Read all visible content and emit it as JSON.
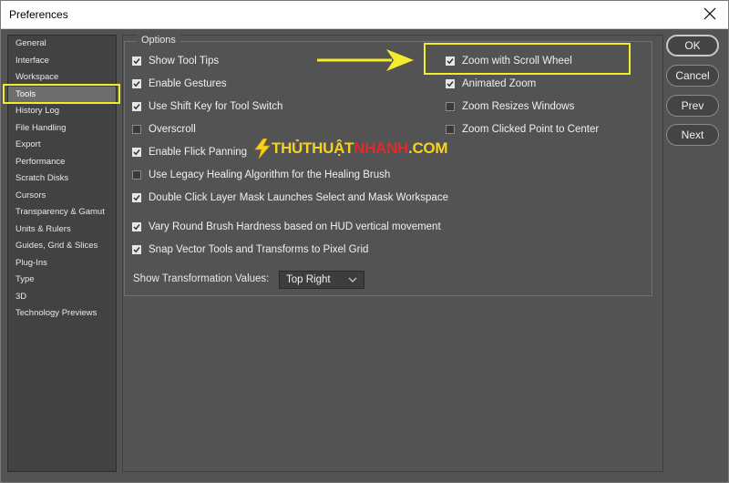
{
  "window": {
    "title": "Preferences"
  },
  "sidebar": {
    "items": [
      {
        "label": "General"
      },
      {
        "label": "Interface"
      },
      {
        "label": "Workspace"
      },
      {
        "label": "Tools",
        "active": true
      },
      {
        "label": "History Log"
      },
      {
        "label": "File Handling"
      },
      {
        "label": "Export"
      },
      {
        "label": "Performance"
      },
      {
        "label": "Scratch Disks"
      },
      {
        "label": "Cursors"
      },
      {
        "label": "Transparency & Gamut"
      },
      {
        "label": "Units & Rulers"
      },
      {
        "label": "Guides, Grid & Slices"
      },
      {
        "label": "Plug-Ins"
      },
      {
        "label": "Type"
      },
      {
        "label": "3D"
      },
      {
        "label": "Technology Previews"
      }
    ]
  },
  "options": {
    "group_label": "Options",
    "left": [
      {
        "label": "Show Tool Tips",
        "checked": true
      },
      {
        "label": "Enable Gestures",
        "checked": true
      },
      {
        "label": "Use Shift Key for Tool Switch",
        "checked": true
      },
      {
        "label": "Overscroll",
        "checked": false
      },
      {
        "label": "Enable Flick Panning",
        "checked": true
      },
      {
        "label": "Use Legacy Healing Algorithm for the Healing Brush",
        "checked": false
      },
      {
        "label": "Double Click Layer Mask Launches Select and Mask Workspace",
        "checked": true
      },
      {
        "label": "Vary Round Brush Hardness based on HUD vertical movement",
        "checked": true
      },
      {
        "label": "Snap Vector Tools and Transforms to Pixel Grid",
        "checked": true
      }
    ],
    "right": [
      {
        "label": "Zoom with Scroll Wheel",
        "checked": true
      },
      {
        "label": "Animated Zoom",
        "checked": true
      },
      {
        "label": "Zoom Resizes Windows",
        "checked": false
      },
      {
        "label": "Zoom Clicked Point to Center",
        "checked": false
      }
    ],
    "transform_label": "Show Transformation Values:",
    "transform_value": "Top Right"
  },
  "buttons": {
    "ok": "OK",
    "cancel": "Cancel",
    "prev": "Prev",
    "next": "Next"
  },
  "watermark": {
    "part1": "THỦTHUẬT",
    "part2": "NHANH",
    "part3": ".COM"
  },
  "colors": {
    "highlight": "#f3eb2c",
    "background": "#535353",
    "sidebar": "#424242"
  }
}
